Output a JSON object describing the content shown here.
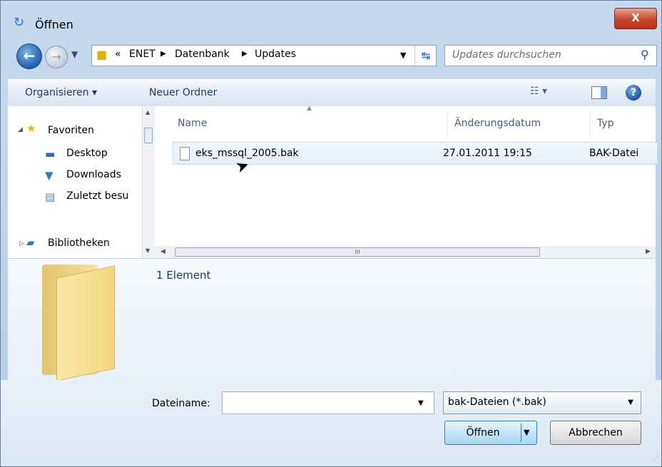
{
  "window": {
    "title": "Öffnen",
    "close_label": "X"
  },
  "navigation": {
    "breadcrumb_prefix": "«",
    "breadcrumb": [
      "ENET",
      "Datenbank",
      "Updates"
    ],
    "search_placeholder": "Updates durchsuchen"
  },
  "toolbar": {
    "organize_label": "Organisieren ▾",
    "new_folder_label": "Neuer Ordner",
    "help_label": "?"
  },
  "nav_pane": {
    "items": [
      {
        "label": "Favoriten",
        "icon": "star-icon"
      },
      {
        "label": "Desktop",
        "icon": "desktop-icon"
      },
      {
        "label": "Downloads",
        "icon": "downloads-folder-icon"
      },
      {
        "label": "Zuletzt besu",
        "icon": "recent-places-icon"
      },
      {
        "label": "Bibliotheken",
        "icon": "libraries-icon"
      }
    ]
  },
  "file_list": {
    "columns": [
      "Name",
      "Änderungsdatum",
      "Typ"
    ],
    "rows": [
      {
        "name": "eks_mssql_2005.bak",
        "date": "27.01.2011 19:15",
        "type": "BAK-Datei"
      }
    ],
    "scroll_thumb_grip": "III"
  },
  "details": {
    "count": "1 Element"
  },
  "bottom": {
    "filename_label": "Dateiname:",
    "filename_value": "",
    "filter_value": "bak-Dateien (*.bak)",
    "open_label": "Öffnen",
    "cancel_label": "Abbrechen"
  },
  "colors": {
    "window_frame": "#b9cfe6",
    "close_button": "#c7452c",
    "open_button": "#c4e5f6",
    "selection": "#e5eefa"
  }
}
